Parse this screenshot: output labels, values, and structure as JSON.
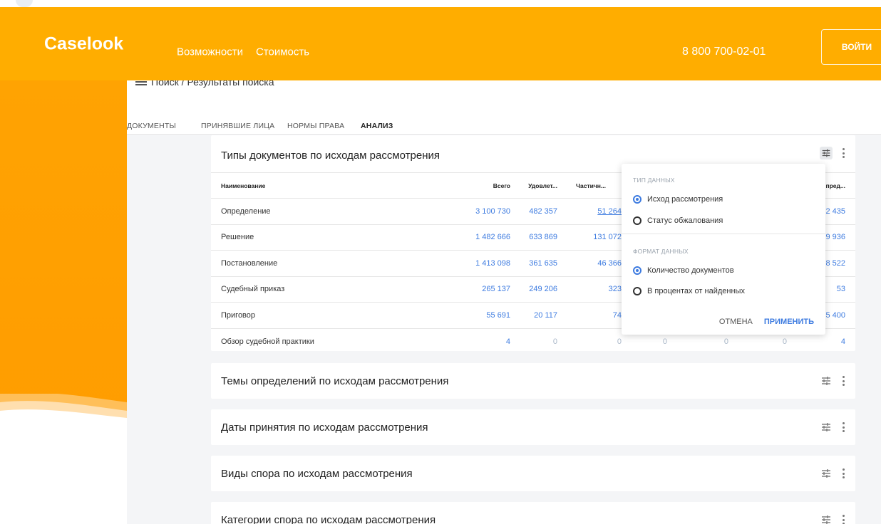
{
  "header": {
    "logo": "Caselook",
    "nav": [
      "Возможности",
      "Стоимость"
    ],
    "phone": "8 800 700-02-01",
    "login": "ВОЙТИ"
  },
  "breadcrumb": "Поиск / Результаты поиска",
  "tabs": [
    "ДОКУМЕНТЫ",
    "ПРИНЯВШИЕ ЛИЦА",
    "НОРМЫ ПРАВА",
    "АНАЛИЗ"
  ],
  "active_tab": "АНАЛИЗ",
  "main_card": {
    "title": "Типы документов по исходам рассмотрения",
    "columns": [
      "Наименование",
      "Всего",
      "Удовлет...",
      "Частичн...",
      "пред..."
    ],
    "rows": [
      {
        "name": "Определение",
        "total": "3 100 730",
        "sat": "482 357",
        "part": "51 264",
        "last": "2 435"
      },
      {
        "name": "Решение",
        "total": "1 482 666",
        "sat": "633 869",
        "part": "131 072",
        "last": "9 936"
      },
      {
        "name": "Постановление",
        "total": "1 413 098",
        "sat": "361 635",
        "part": "46 366",
        "last": "8 522"
      },
      {
        "name": "Судебный приказ",
        "total": "265 137",
        "sat": "249 206",
        "part": "323",
        "last": "53"
      },
      {
        "name": "Приговор",
        "total": "55 691",
        "sat": "20 117",
        "part": "74",
        "last": "5 400"
      },
      {
        "name": "Обзор судебной практики",
        "total": "4",
        "sat": "0",
        "part": "0",
        "mid1": "0",
        "mid2": "0",
        "mid3": "0",
        "last": "4"
      }
    ]
  },
  "popover": {
    "data_type_label": "ТИП ДАННЫХ",
    "data_type_options": [
      "Исход рассмотрения",
      "Статус обжалования"
    ],
    "data_format_label": "ФОРМАТ ДАННЫХ",
    "data_format_options": [
      "Количество документов",
      "В процентах от найденных"
    ],
    "cancel": "ОТМЕНА",
    "apply": "ПРИМЕНИТЬ"
  },
  "cards": [
    {
      "title": "Темы определений по исходам рассмотрения"
    },
    {
      "title": "Даты принятия по исходам рассмотрения"
    },
    {
      "title": "Виды спора по исходам рассмотрения"
    },
    {
      "title": "Категории спора по исходам рассмотрения"
    }
  ],
  "colors": {
    "brand": "#ffad00",
    "link": "#3d7be0",
    "tab_underline": "#f4b63c"
  },
  "icons": [
    "filter-sliders-icon",
    "more-vertical-icon",
    "menu-icon"
  ]
}
